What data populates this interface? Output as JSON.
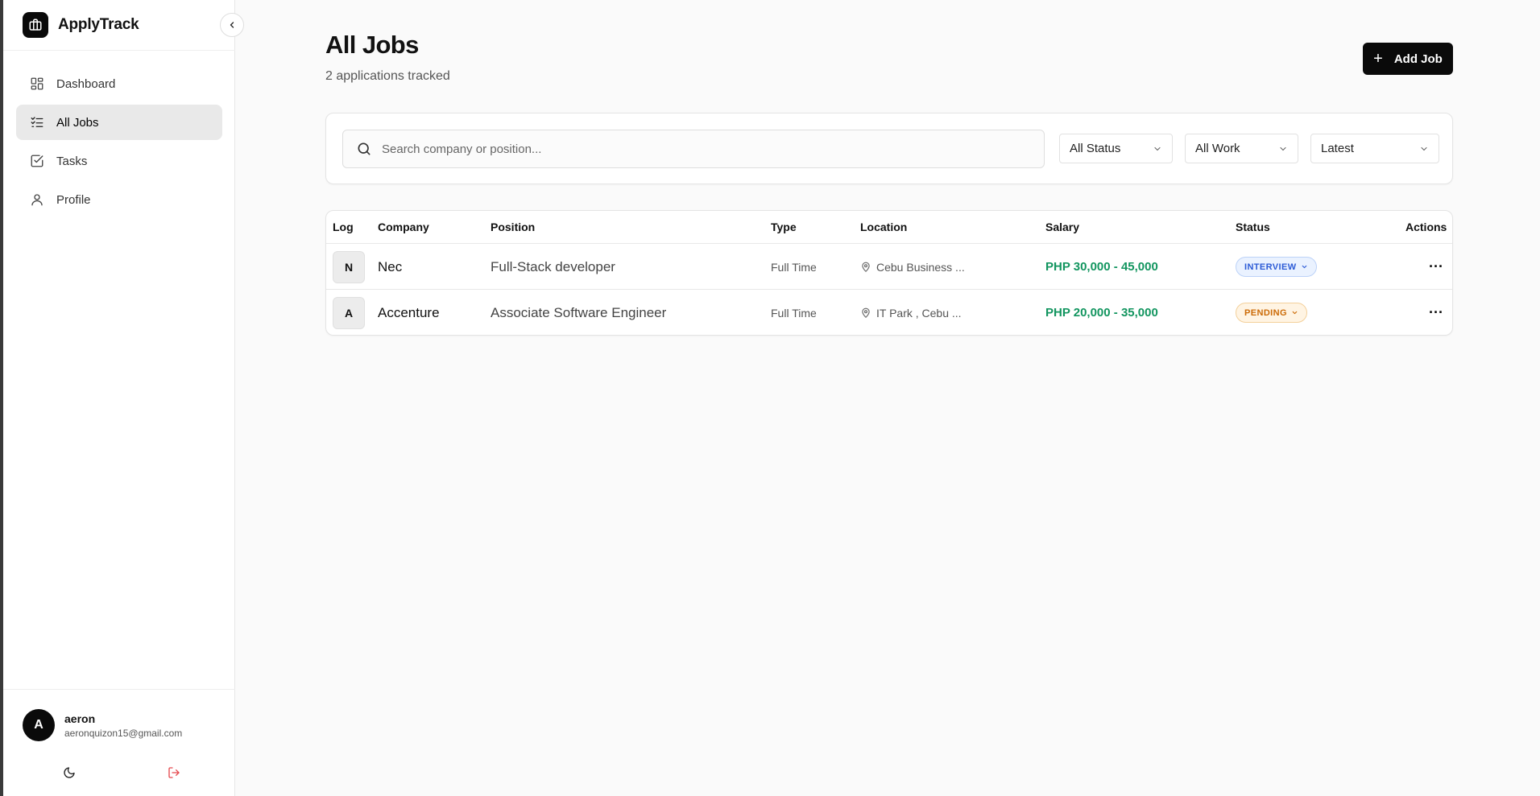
{
  "app": {
    "name": "ApplyTrack"
  },
  "sidebar": {
    "items": [
      {
        "label": "Dashboard",
        "icon": "dashboard-icon",
        "active": false
      },
      {
        "label": "All Jobs",
        "icon": "list-checks-icon",
        "active": true
      },
      {
        "label": "Tasks",
        "icon": "checkbox-icon",
        "active": false
      },
      {
        "label": "Profile",
        "icon": "user-icon",
        "active": false
      }
    ],
    "user": {
      "initial": "A",
      "name": "aeron",
      "email": "aeronquizon15@gmail.com"
    }
  },
  "header": {
    "title": "All Jobs",
    "subtitle": "2 applications tracked",
    "add_label": "Add Job"
  },
  "filters": {
    "search_placeholder": "Search company or position...",
    "status": "All Status",
    "work": "All Work",
    "sort": "Latest"
  },
  "table": {
    "columns": [
      "Log",
      "Company",
      "Position",
      "Type",
      "Location",
      "Salary",
      "Status",
      "Actions"
    ],
    "rows": [
      {
        "initial": "N",
        "company": "Nec",
        "position": "Full-Stack developer",
        "type": "Full Time",
        "location": "Cebu Business ...",
        "salary": "PHP 30,000 - 45,000",
        "status": "INTERVIEW",
        "actions": "···"
      },
      {
        "initial": "A",
        "company": "Accenture",
        "position": "Associate Software Engineer",
        "type": "Full Time",
        "location": "IT Park , Cebu ...",
        "salary": "PHP 20,000 - 35,000",
        "status": "PENDING",
        "actions": "···"
      }
    ]
  },
  "colors": {
    "accent": "#0a0a0a",
    "salary": "#12955f",
    "interview": "#2c5bd6",
    "pending": "#cc6b07",
    "logout": "#e5484d"
  }
}
